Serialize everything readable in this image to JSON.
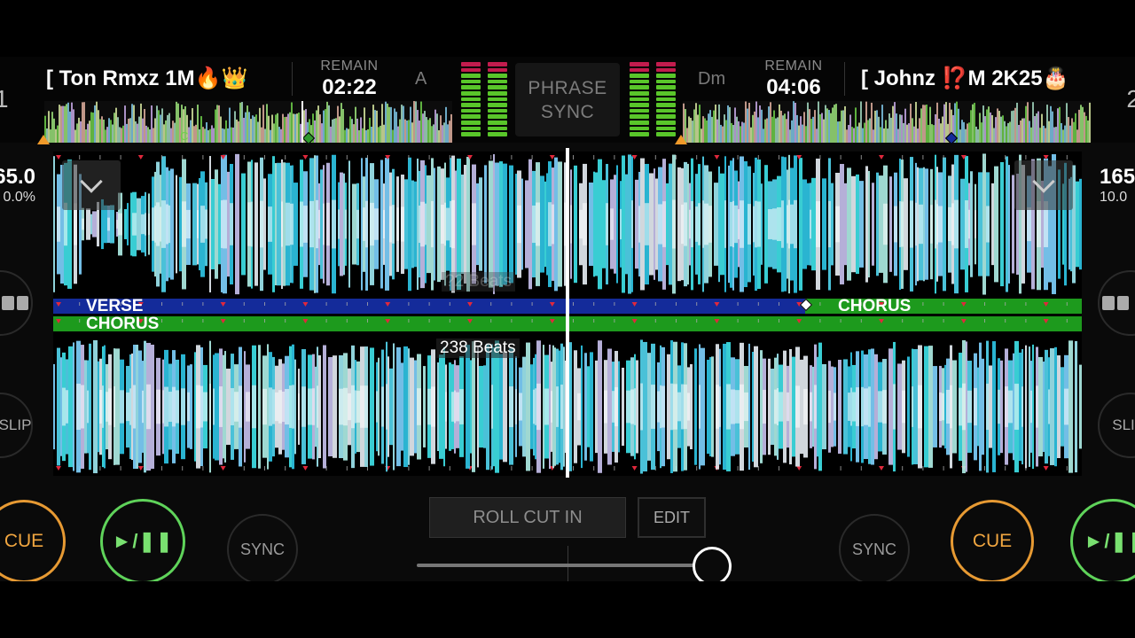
{
  "colors": {
    "cue": "#e79a33",
    "play": "#5fd35a",
    "verse": "#142b9a",
    "chorus": "#1d9a1d",
    "wave_cyan": "#3fe3ea",
    "meter_green": "#59c62a",
    "meter_red": "#c21c4e"
  },
  "deck_left": {
    "number": "1",
    "title": "[ Ton Rmxz 1M🔥👑",
    "remain_label": "REMAIN",
    "remain_time": "02:22",
    "key": "A",
    "bpm": "65.0",
    "pitch": "0.0%",
    "overview_marker": "C",
    "meter_level": 0.85
  },
  "deck_right": {
    "number": "2",
    "title": "[ Johnz ⁉️M 2K25🎂",
    "remain_label": "REMAIN",
    "remain_time": "04:06",
    "key": "Dm",
    "bpm": "165",
    "pitch": "10.0",
    "meter_level": 0.85
  },
  "center": {
    "phrase_sync_line1": "PHRASE",
    "phrase_sync_line2": "SYNC"
  },
  "waveform": {
    "top_phrase_left": "VERSE",
    "top_phrase_right": "CHORUS",
    "bottom_phrase_left": "CHORUS",
    "top_beats_ghost": "?2 Beats",
    "bottom_beats": "238 Beats"
  },
  "side_controls": {
    "slip_label": "SLIP",
    "slip_label_right": "SLI"
  },
  "bottom": {
    "cue_label": "CUE",
    "play_label": "►/❚❚",
    "sync_label": "SYNC",
    "roll_cut_in_label": "ROLL CUT IN",
    "edit_label": "EDIT",
    "crossfader_position": 1.0
  },
  "icons": {
    "collapse": "chevron-down-icon",
    "toggle": "toggle-icon"
  }
}
